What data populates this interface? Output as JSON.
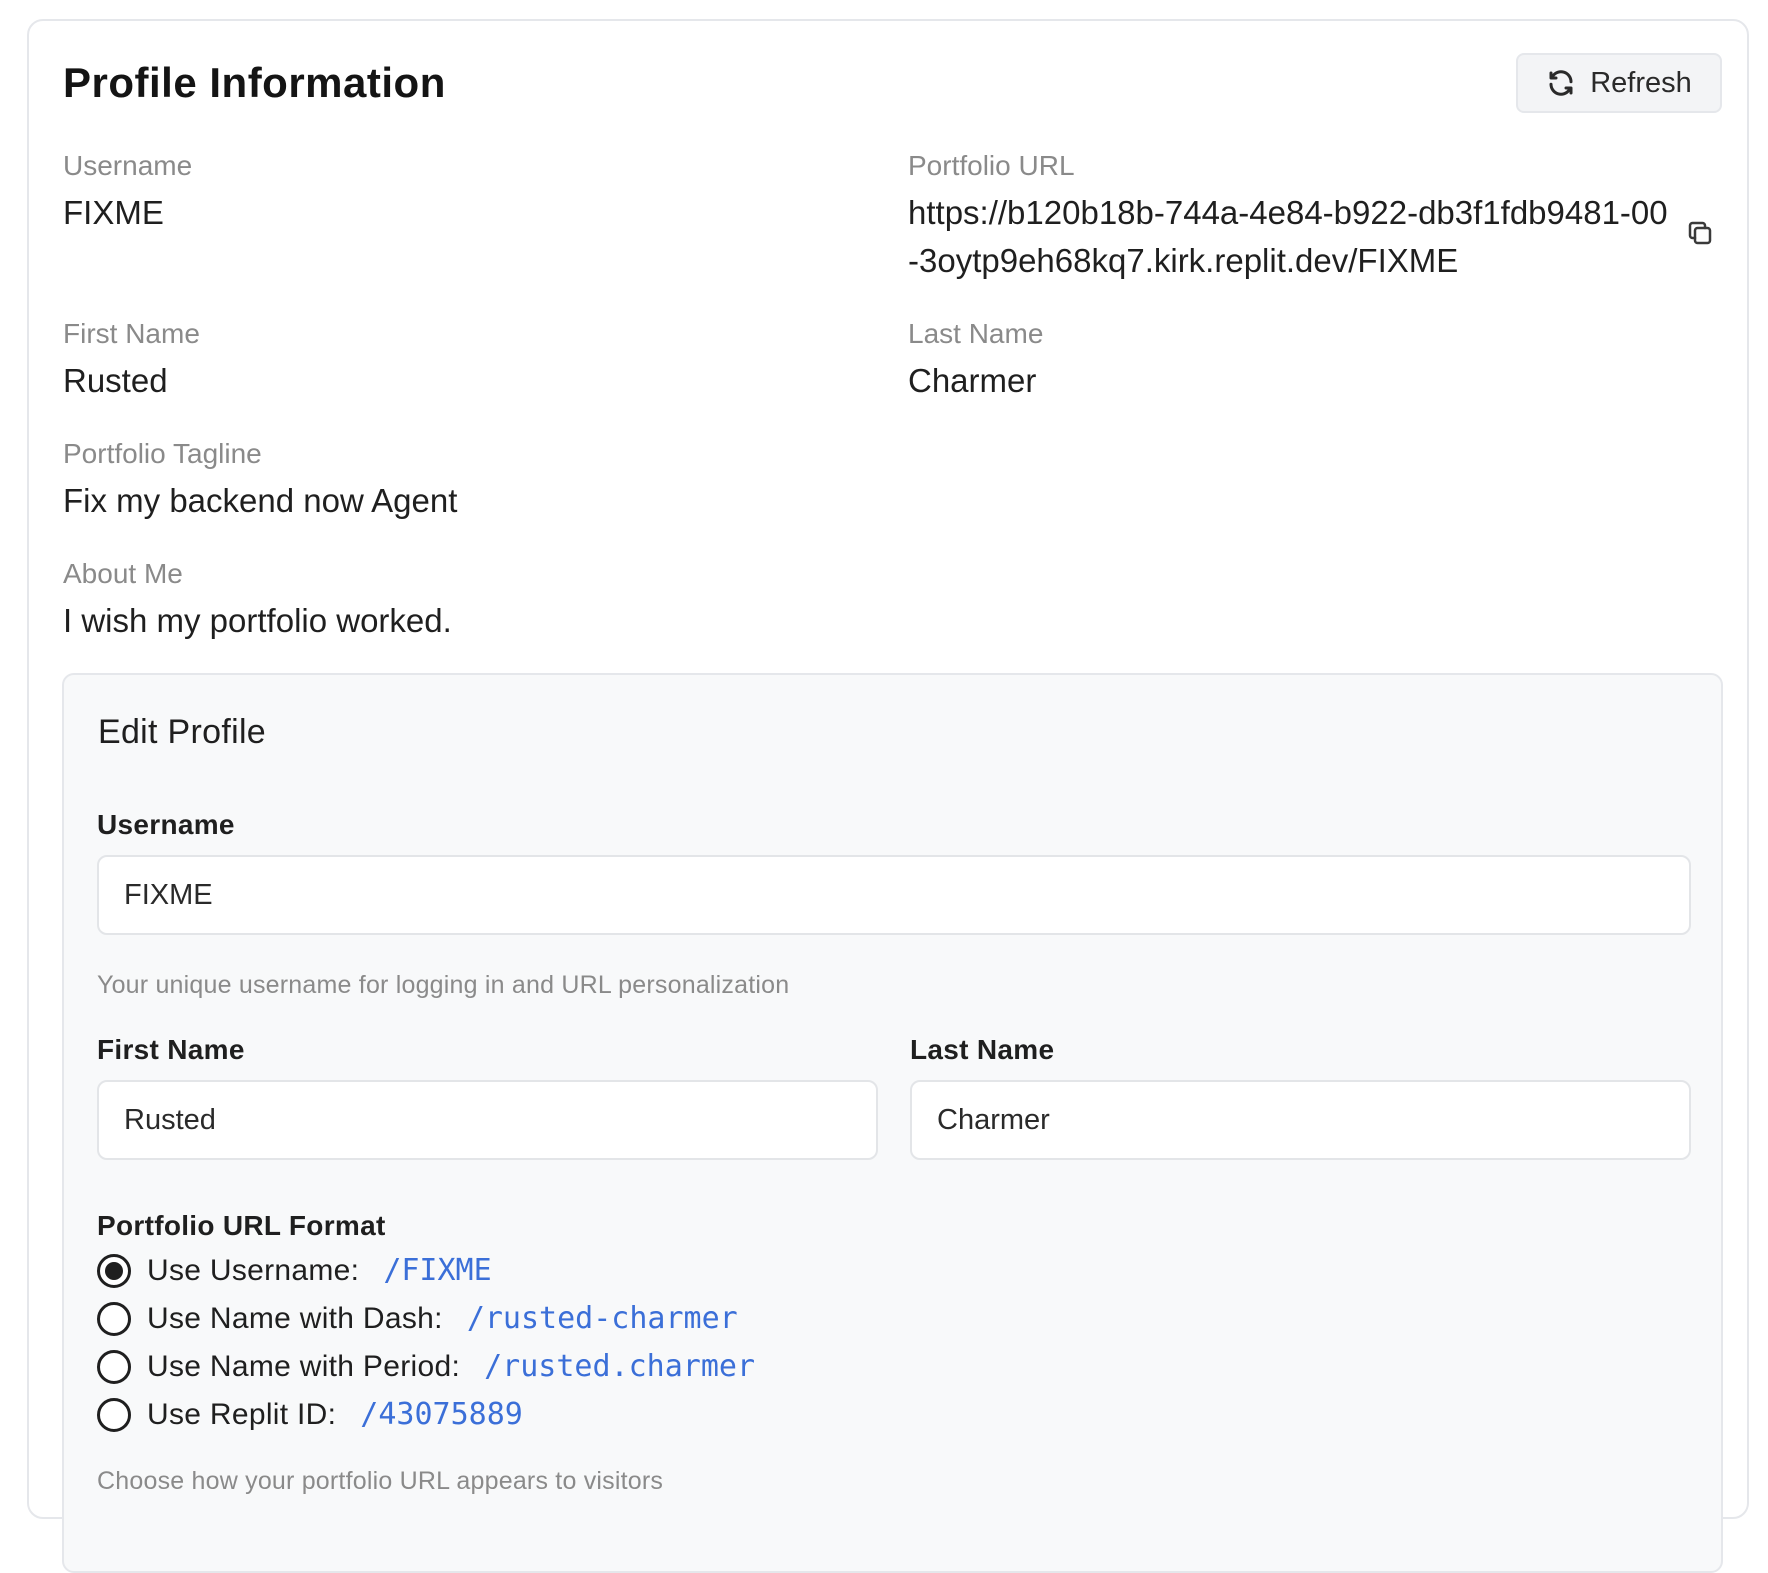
{
  "profile": {
    "title": "Profile Information",
    "refresh_label": "Refresh",
    "username_label": "Username",
    "username_value": "FIXME",
    "portfolio_url_label": "Portfolio URL",
    "portfolio_url_value": "https://b120b18b-744a-4e84-b922-db3f1fdb9481-00-3oytp9eh68kq7.kirk.replit.dev/FIXME",
    "first_name_label": "First Name",
    "first_name_value": "Rusted",
    "last_name_label": "Last Name",
    "last_name_value": "Charmer",
    "tagline_label": "Portfolio Tagline",
    "tagline_value": "Fix my backend now Agent",
    "about_label": "About Me",
    "about_value": "I wish my portfolio worked."
  },
  "edit": {
    "title": "Edit Profile",
    "username_label": "Username",
    "username_value": "FIXME",
    "username_help": "Your unique username for logging in and URL personalization",
    "first_name_label": "First Name",
    "first_name_value": "Rusted",
    "last_name_label": "Last Name",
    "last_name_value": "Charmer",
    "url_format_label": "Portfolio URL Format",
    "url_format_options": [
      {
        "label": "Use Username:",
        "path": "/FIXME",
        "selected": true
      },
      {
        "label": "Use Name with Dash:",
        "path": "/rusted-charmer",
        "selected": false
      },
      {
        "label": "Use Name with Period:",
        "path": "/rusted.charmer",
        "selected": false
      },
      {
        "label": "Use Replit ID:",
        "path": "/43075889",
        "selected": false
      }
    ],
    "url_format_help": "Choose how your portfolio URL appears to visitors"
  },
  "colors": {
    "link_blue": "#3b6fd8",
    "muted_text": "#8a8a8a",
    "panel_bg": "#f8f9fa"
  },
  "icons": {
    "refresh": "refresh-icon",
    "copy": "copy-icon"
  }
}
